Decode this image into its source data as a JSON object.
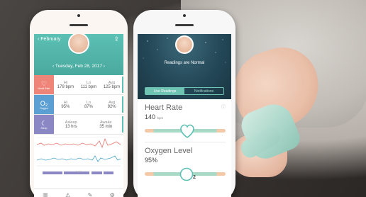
{
  "colors": {
    "teal": "#5cc0b4",
    "navy": "#244858",
    "heart_rate": "#ef8579",
    "oxygen": "#5c9fd2",
    "sleep": "#8b87c4"
  },
  "left_app": {
    "back_label": "February",
    "date": "Tuesday, Feb 28, 2017",
    "metrics": [
      {
        "tile_icon": "heart-icon",
        "tile_label": "Heart Rate",
        "hi_label": "Hi",
        "hi": "178 bpm",
        "lo_label": "Lo",
        "lo": "111 bpm",
        "avg_label": "Avg",
        "avg": "125 bpm"
      },
      {
        "tile_icon": "oxygen-icon",
        "tile_label": "Oxygen",
        "hi_label": "Hi",
        "hi": "95%",
        "lo_label": "Lo",
        "lo": "87%",
        "avg_label": "Avg",
        "avg": "92%"
      },
      {
        "tile_icon": "sleep-icon",
        "tile_label": "Sleep",
        "hi_label": "Asleep",
        "hi": "13 hrs",
        "avg_label": "Awake",
        "avg": "35 min"
      }
    ],
    "tab_icons": [
      "bar-chart-icon",
      "warning-icon",
      "pen-icon",
      "settings-icon"
    ]
  },
  "right_app": {
    "status": "Readings are Normal",
    "tabs": [
      "Live Readings",
      "Notifications"
    ],
    "heart": {
      "title": "Heart Rate",
      "value": "140",
      "unit": "bpm"
    },
    "oxygen": {
      "title": "Oxygen Level",
      "value": "95%",
      "gauge_marker": "2"
    }
  }
}
